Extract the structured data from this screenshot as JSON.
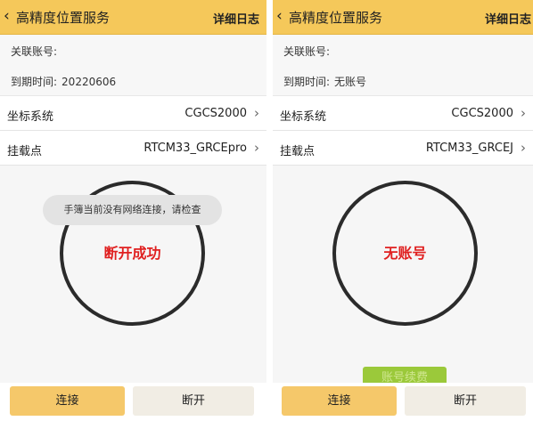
{
  "left": {
    "back_icon": "chevron-left-icon",
    "title": "高精度位置服务",
    "log_label": "详细日志",
    "account_label": "关联账号:",
    "account_value": "",
    "expiry_label": "到期时间:",
    "expiry_value": "20220606",
    "coord_label": "坐标系统",
    "coord_value": "CGCS2000",
    "mount_label": "挂载点",
    "mount_value": "RTCM33_GRCEpro",
    "status_text": "断开成功",
    "toast_text": "手簿当前没有网络连接，请检查",
    "connect_label": "连接",
    "disconnect_label": "断开"
  },
  "right": {
    "back_icon": "chevron-left-icon",
    "title": "高精度位置服务",
    "log_label": "详细日志",
    "account_label": "关联账号:",
    "account_value": "",
    "expiry_label": "到期时间:",
    "expiry_value": "无账号",
    "coord_label": "坐标系统",
    "coord_value": "CGCS2000",
    "mount_label": "挂载点",
    "mount_value": "RTCM33_GRCEJ",
    "status_text": "无账号",
    "partial_button_text": "账号续费",
    "connect_label": "连接",
    "disconnect_label": "断开"
  },
  "colors": {
    "topbar": "#f5c85a",
    "status_text": "#e02020",
    "connect_button": "#f5c86a",
    "disconnect_button": "#f1ede4"
  }
}
